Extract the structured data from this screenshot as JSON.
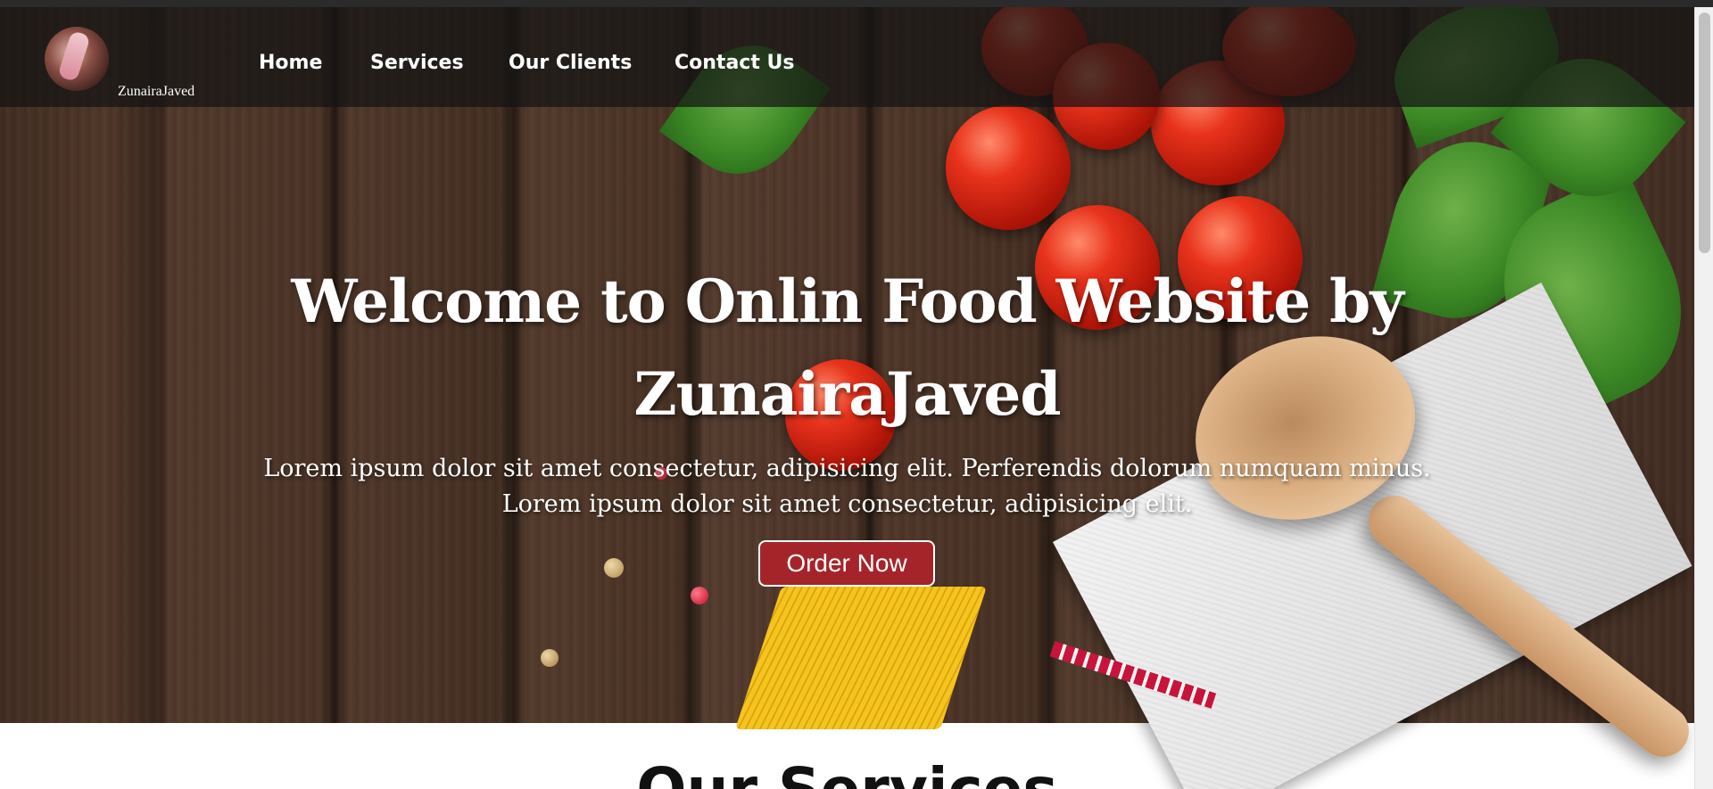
{
  "brand": {
    "name": "ZunairaJaved",
    "logo_icon": "avatar-photo"
  },
  "nav": {
    "items": [
      {
        "label": "Home"
      },
      {
        "label": "Services"
      },
      {
        "label": "Our Clients"
      },
      {
        "label": "Contact Us"
      }
    ]
  },
  "hero": {
    "title_line1": "Welcome to Onlin Food Website by",
    "title_line2": "ZunairaJaved",
    "subtitle_line1": "Lorem ipsum dolor sit amet consectetur, adipisicing elit. Perferendis dolorum numquam minus.",
    "subtitle_line2": "Lorem ipsum dolor sit amet consectetur, adipisicing elit.",
    "cta_label": "Order Now",
    "cta_color": "#a5242a"
  },
  "services": {
    "heading": "Our Services"
  }
}
